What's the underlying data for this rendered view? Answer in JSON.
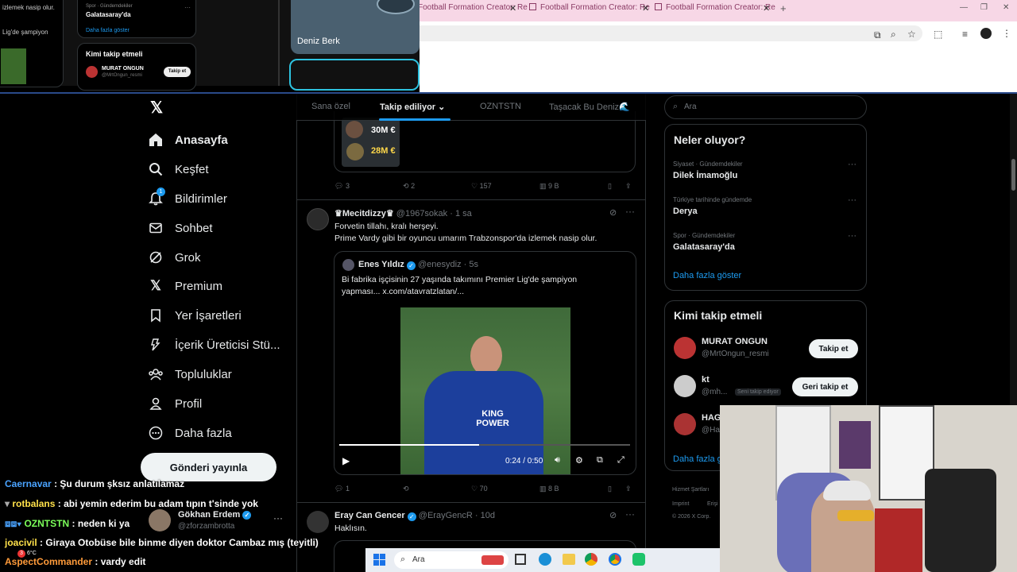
{
  "overlay": {
    "snippet_top": "izlemek nasip olur.",
    "snippet_left": "Lig'de şampiyon",
    "trend_meta": "Spor · Gündemdekiler",
    "trend_name": "Galatasaray'da",
    "show_more": "Daha fazla göster",
    "who_follow": "Kimi takip etmeli",
    "user_name": "MURAT ONGUN",
    "user_handle": "@MrtOngun_resmi",
    "follow_btn": "Takip et",
    "person_name": "Deniz Berk"
  },
  "browser": {
    "tabs": [
      {
        "label": "Football Formation Creator: Re"
      },
      {
        "label": "Football Formation Creator: Re"
      },
      {
        "label": "Football Formation Creator: Re"
      }
    ],
    "new_tab": "+"
  },
  "sidebar": {
    "items": [
      {
        "label": "Anasayfa"
      },
      {
        "label": "Keşfet"
      },
      {
        "label": "Bildirimler"
      },
      {
        "label": "Sohbet"
      },
      {
        "label": "Grok"
      },
      {
        "label": "Premium"
      },
      {
        "label": "Yer İşaretleri"
      },
      {
        "label": "İçerik Üreticisi Stü..."
      },
      {
        "label": "Topluluklar"
      },
      {
        "label": "Profil"
      },
      {
        "label": "Daha fazla"
      }
    ],
    "notification_badge": "1",
    "post_button": "Gönderi yayınla"
  },
  "feed": {
    "tabs": [
      "Sana özel",
      "Takip ediliyor",
      "OZNTSTN",
      "Taşacak Bu Deniz🌊"
    ],
    "prev_post": {
      "price1": "30M €",
      "price2": "28M €",
      "replies": "3",
      "reposts": "2",
      "likes": "157",
      "views": "9 B"
    },
    "post1": {
      "name": "♛Mecitdizzy♛",
      "handle": "@1967sokak",
      "time": "1 sa",
      "line1": "Forvetin tillahı, kralı herşeyi.",
      "line2": "Prime Vardy gibi bir oyuncu umarım Trabzonspor'da izlemek nasip olur.",
      "quote_name": "Enes Yıldız",
      "quote_handle": "@enesydiz",
      "quote_time": "5s",
      "quote_text": "Bi fabrika işçisinin 27 yaşında takımını Premier Lig'de şampiyon yapması... x.com/atavratzlatan/...",
      "jersey_text": "KING POWER",
      "video_time": "0:24 / 0:50",
      "video_progress": 0.48,
      "replies": "1",
      "likes": "70",
      "views": "8 B"
    },
    "post2": {
      "name": "Eray Can Gencer",
      "handle": "@ErayGencR",
      "time": "10d",
      "text": "Haklısın."
    }
  },
  "right": {
    "search_placeholder": "Ara",
    "trends_title": "Neler oluyor?",
    "trends": [
      {
        "meta": "Siyaset · Gündemdekiler",
        "name": "Dilek İmamoğlu"
      },
      {
        "meta": "Türkiye tarihinde gündemde",
        "name": "Derya"
      },
      {
        "meta": "Spor · Gündemdekiler",
        "name": "Galatasaray'da"
      }
    ],
    "show_more": "Daha fazla göster",
    "wtf_title": "Kimi takip etmeli",
    "wtf": [
      {
        "name": "MURAT ONGUN",
        "handle": "@MrtOngun_resmi",
        "button": "Takip et"
      },
      {
        "name": "kt",
        "handle": "@mh...",
        "badge": "Seni takip ediyor",
        "button": "Geri takip et"
      },
      {
        "name": "HAG",
        "handle": "@Ha"
      }
    ],
    "wtf_more": "Daha fazla g",
    "footer1": "Hizmet Şartları",
    "footer2": "Imprint",
    "footer3": "Erişi",
    "copyright": "© 2026 X Corp."
  },
  "chat": [
    {
      "user": "Caernavar",
      "text": ": Şu durum şksız anlatılamaz",
      "color": "#4aa3ff"
    },
    {
      "user": "rotbalans",
      "text": ": abi yemin ederim bu adam tıpın t'sinde yok",
      "color": "#ffe14a"
    },
    {
      "user": "OZNTSTN",
      "text": ": neden ki ya",
      "color": "#7cff5a"
    },
    {
      "user": "joacivil",
      "text": ": Giraya Otobüse bile binme diyen doktor Cambaz mış (teyitli)",
      "color": "#ffe14a"
    },
    {
      "user": "AspectCommander",
      "text": ": vardy edit",
      "color": "#ff9b3a"
    }
  ],
  "chat_extra": {
    "name": "Gökhan Erdem",
    "handle": "@zforzambrotta",
    "weather_temp": "6°C",
    "chat_badge": "3"
  },
  "taskbar": {
    "search": "Ara"
  },
  "colors": {
    "accent": "#1d9bf0",
    "background": "#000000",
    "border": "#2f3336",
    "muted": "#71767b"
  }
}
